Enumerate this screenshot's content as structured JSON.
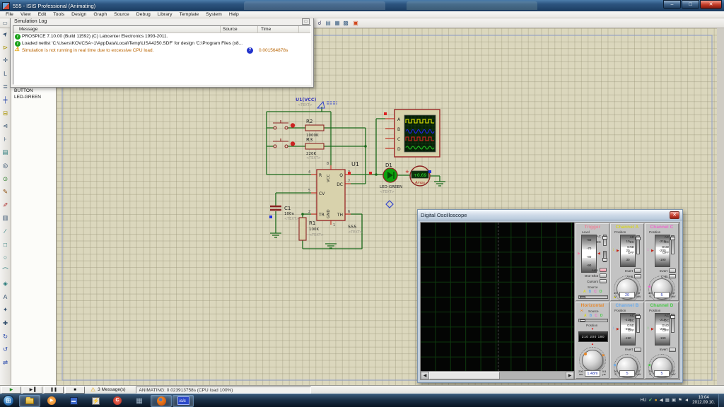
{
  "titlebar": {
    "title": "555 - ISIS Professional (Animating)"
  },
  "menu": [
    "File",
    "View",
    "Edit",
    "Tools",
    "Design",
    "Graph",
    "Source",
    "Debug",
    "Library",
    "Template",
    "System",
    "Help"
  ],
  "left_toolbar_icons": [
    "selection-pointer",
    "component-mode",
    "junction-dot",
    "wire-label",
    "text-script",
    "buses",
    "subcircuit",
    "terminals",
    "device-pins",
    "graph-mode",
    "tape-recorder",
    "generator-mode",
    "voltage-probe",
    "current-probe",
    "virtual-instruments",
    "2d-line",
    "2d-box",
    "2d-circle",
    "2d-arc",
    "2d-path",
    "2d-text",
    "2d-symbol",
    "marker",
    "rotate-clockwise",
    "rotate-anticlockwise",
    "mirror"
  ],
  "simulation_log": {
    "title": "Simulation Log",
    "columns": [
      "Message",
      "Source",
      "Time"
    ],
    "rows": [
      {
        "severity": "info",
        "message": "PROSPICE 7.10.00 (Build 11592) (C) Labcenter Electronics 1993-2011.",
        "source": "",
        "time": ""
      },
      {
        "severity": "info",
        "message": "Loaded netlist 'C:\\Users\\KOVCSA~1\\AppData\\Local\\Temp\\LISA4250.SDF' for design 'C:\\Program Files (x8...",
        "source": "",
        "time": ""
      },
      {
        "severity": "warning",
        "message": "Simulation is not running in real time due to excessive CPU load.",
        "source": "?",
        "time": "0.001564878s"
      }
    ]
  },
  "object_selector": {
    "items": [
      "BUTTON",
      "LED-GREEN"
    ]
  },
  "schematic": {
    "power": {
      "label": "U1(VCC)",
      "text": "<TEXT>"
    },
    "r1": {
      "ref": "R1",
      "value": "100K",
      "text": "<TEXT>"
    },
    "r2": {
      "ref": "R2",
      "value": "1000K"
    },
    "r3": {
      "ref": "R3",
      "value": "220K",
      "text": "<TEXT>"
    },
    "c1": {
      "ref": "C1",
      "value": "100n",
      "text": "<TEXT>"
    },
    "u1": {
      "ref": "U1",
      "device": "555",
      "text": "<TEXT>",
      "pins": {
        "r": "R",
        "cv": "CV",
        "tr": "TR",
        "q": "Q",
        "dc": "DC",
        "th": "TH",
        "vcc": "VCC",
        "gnd": "GND"
      },
      "pin_numbers": {
        "r": "4",
        "cv": "5",
        "tr": "2",
        "q": "3",
        "dc": "7",
        "th": "6",
        "vcc": "8",
        "gnd": "1"
      }
    },
    "d1": {
      "ref": "D1",
      "device": "LED-GREEN",
      "text": "<TEXT>"
    },
    "ammeter": {
      "plus": "+",
      "reading": "+0.69",
      "label": "Amps"
    },
    "scope_part": {
      "pins": [
        "A",
        "B",
        "C",
        "D"
      ]
    }
  },
  "oscilloscope": {
    "title": "Digital Oscilloscope",
    "coupling": [
      "AC",
      "DC",
      "GND",
      "OFF"
    ],
    "source_colors": [
      "#d8d520",
      "#66aaee",
      "#ee66cc",
      "#44cc44"
    ],
    "trigger": {
      "title": "Trigger",
      "color": "#f08098",
      "level_label": "Level",
      "ticks": [
        "-60",
        "-70",
        "-80",
        "-90"
      ],
      "ac": "AC",
      "dc": "DC",
      "auto": "Auto",
      "one_shot": "One-Shot",
      "cursors": "Cursors",
      "source_label": "Source",
      "sources": [
        "A",
        "B",
        "C",
        "D"
      ]
    },
    "horizontal": {
      "title": "Horizontal",
      "color": "#e8882a",
      "source_label": "Source",
      "sources": [
        "A",
        "B",
        "C",
        "D"
      ],
      "position_label": "Position",
      "dial": "210  200  190",
      "range_min": "200",
      "range_min_unit": "ms",
      "value": "1.48m",
      "range_max": "0.5",
      "range_max_unit": "µs"
    },
    "channels": [
      {
        "title": "Channel A",
        "color": "#d8d520",
        "position_label": "Position",
        "ticks": [
          "10",
          "20",
          "30"
        ],
        "invert": "Invert",
        "combine": "A+B",
        "range_min": "20",
        "range_min_unit": "V",
        "value": "20",
        "range_max": "2",
        "range_max_unit": "mV"
      },
      {
        "title": "Channel C",
        "color": "#ee66cc",
        "position_label": "Position",
        "ticks": [
          "-210",
          "-200",
          "-190"
        ],
        "invert": "Invert",
        "combine": "C+D",
        "range_min": "20",
        "range_min_unit": "V",
        "value": "5",
        "range_max": "2",
        "range_max_unit": "mV"
      },
      {
        "title": "Channel B",
        "color": "#66aaee",
        "position_label": "Position",
        "ticks": [
          "-210",
          "-200",
          "-190"
        ],
        "invert": "Invert",
        "combine": "",
        "range_min": "20",
        "range_min_unit": "V",
        "value": "5",
        "range_max": "2",
        "range_max_unit": "mV"
      },
      {
        "title": "Channel D",
        "color": "#44cc44",
        "position_label": "Position",
        "ticks": [
          "-210",
          "-200",
          "-190"
        ],
        "invert": "Invert",
        "combine": "",
        "range_min": "20",
        "range_min_unit": "V",
        "value": "5",
        "range_max": "2",
        "range_max_unit": "mV"
      }
    ]
  },
  "status_bar": {
    "messages": "3 Message(s)",
    "animating": "ANIMATING: 0.023913758s (CPU load 100%)"
  },
  "taskbar": {
    "isis_label": "isis",
    "tray_lang": "HU",
    "time": "10:04",
    "date": "2012.09.10."
  }
}
